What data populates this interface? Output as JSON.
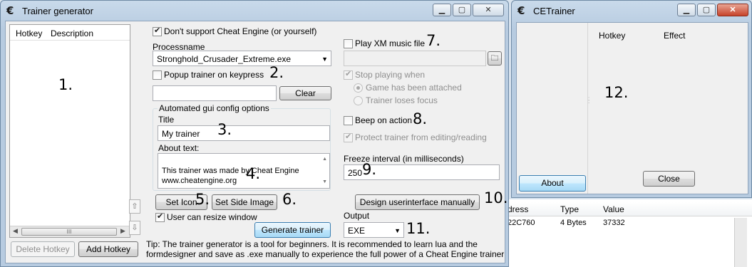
{
  "trainer_window": {
    "title": "Trainer generator",
    "list_columns": [
      "Hotkey",
      "Description"
    ],
    "list_scroll_thumb": "III",
    "delete_hotkey_label": "Delete Hotkey",
    "add_hotkey_label": "Add Hotkey",
    "dont_support_ce_label": "Don't support Cheat Engine (or yourself)",
    "processname_label": "Processname",
    "processname_value": "Stronghold_Crusader_Extreme.exe",
    "popup_on_keypress_label": "Popup trainer on keypress",
    "hotkey_field_value": "",
    "clear_label": "Clear",
    "gui_group_label": "Automated gui config options",
    "title_label": "Title",
    "title_value": "My trainer",
    "about_label": "About text:",
    "about_value": "This trainer was made by Cheat Engine\nwww.cheatengine.org",
    "set_icon_label": "Set Icon",
    "set_side_image_label": "Set Side Image",
    "user_can_resize_label": "User can resize window",
    "generate_label": "Generate trainer",
    "play_xm_label": "Play XM music file",
    "xm_file_value": "",
    "stop_playing_label": "Stop playing when",
    "game_attached_label": "Game has been attached",
    "trainer_loses_focus_label": "Trainer loses focus",
    "beep_label": "Beep on action",
    "protect_label": "Protect trainer from editing/reading",
    "freeze_label": "Freeze interval (in milliseconds)",
    "freeze_value": "250",
    "design_ui_label": "Design userinterface manually",
    "output_label": "Output",
    "output_value": "EXE",
    "tip_text": "Tip: The trainer generator is a tool for beginners. It is recommended to learn lua and the formdesigner and save as .exe manually to experience the full power of a Cheat Engine trainer"
  },
  "ce_window": {
    "title": "CETrainer",
    "hotkey_header": "Hotkey",
    "effect_header": "Effect",
    "about_label": "About",
    "close_label": "Close"
  },
  "background_table": {
    "headers": [
      "dress",
      "Type",
      "Value"
    ],
    "row": [
      "22C760",
      "4 Bytes",
      "37332"
    ]
  },
  "annotations": [
    "1.",
    "2.",
    "3.",
    "4.",
    "5.",
    "6.",
    "7.",
    "8.",
    "9.",
    "10.",
    "11.",
    "12."
  ],
  "icons": {
    "app": "cheat-engine-logo-icon",
    "minimize": "minimize-icon",
    "maximize": "maximize-icon",
    "close": "close-icon",
    "dropdown": "chevron-down-icon",
    "up": "arrow-up-icon",
    "down": "arrow-down-icon",
    "browse": "folder-icon"
  },
  "colors": {
    "titlebar": "#c9daeb",
    "close_button": "#c7432a",
    "generate_button": "#bee6fd"
  }
}
